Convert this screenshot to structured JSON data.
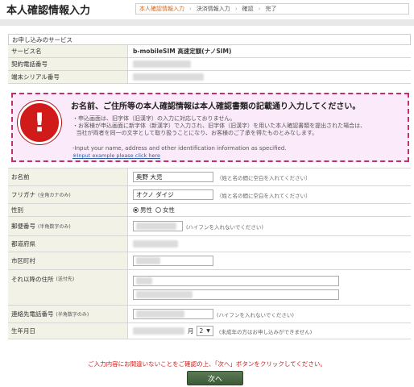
{
  "header": {
    "title": "本人確認情報入力",
    "steps": [
      "本人確認情報入力",
      "決済情報入力",
      "確認",
      "完了"
    ]
  },
  "service": {
    "section_title": "お申し込みのサービス",
    "rows": [
      {
        "label": "サービス名",
        "value": "b-mobileSIM 高速定額(ナノSIM)"
      },
      {
        "label": "契約電話番号",
        "value": ""
      },
      {
        "label": "端末シリアル番号",
        "value": ""
      }
    ]
  },
  "notice": {
    "heading": "お名前、ご住所等の本人確認情報は本人確認書類の記載通り入力してください。",
    "line1": "・申込画面は、旧字体（旧漢字）の入力に対応しておりません。",
    "line2": "・お客様が申込画面に新字体（新漢字）で入力され、旧字体（旧漢字）を用いた本人確認書類を提出された場合は、\n  当社が両者を同一の文字として取り扱うことになり、お客様のご了承を得たものとみなします。",
    "line3": "-Input your name, address and other identification information as specified.",
    "link": "※Input example please click here"
  },
  "form": {
    "name": {
      "label": "お名前",
      "value": "奥野 大児",
      "hint": "（姓と名の間に空白を入れてください）"
    },
    "kana": {
      "label": "フリガナ",
      "label_note": "(全角カナのみ)",
      "value": "オクノ ダイジ",
      "hint": "（姓と名の間に空白を入れてください）"
    },
    "gender": {
      "label": "性別",
      "options": [
        "男性",
        "女性"
      ],
      "selected": "男性"
    },
    "zip": {
      "label": "郵便番号",
      "label_note": "(半角数字のみ)",
      "hint": "(ハイフンを入れないでください)"
    },
    "prefecture": {
      "label": "都道府県"
    },
    "city": {
      "label": "市区町村"
    },
    "address": {
      "label": "それ以降の住所",
      "label_note": "(送付先)"
    },
    "phone": {
      "label": "連絡先電話番号",
      "label_note": "(半角数字のみ)",
      "hint": "(ハイフンを入れないでください)"
    },
    "birth": {
      "label": "生年月日",
      "month_unit": "月",
      "day_value": "2",
      "hint": "(未成年の方はお申し込みができません)"
    }
  },
  "footer": {
    "note": "ご入力内容にお間違いないことをご確認の上、「次へ」ボタンをクリックしてください。",
    "next_label": "次へ"
  }
}
